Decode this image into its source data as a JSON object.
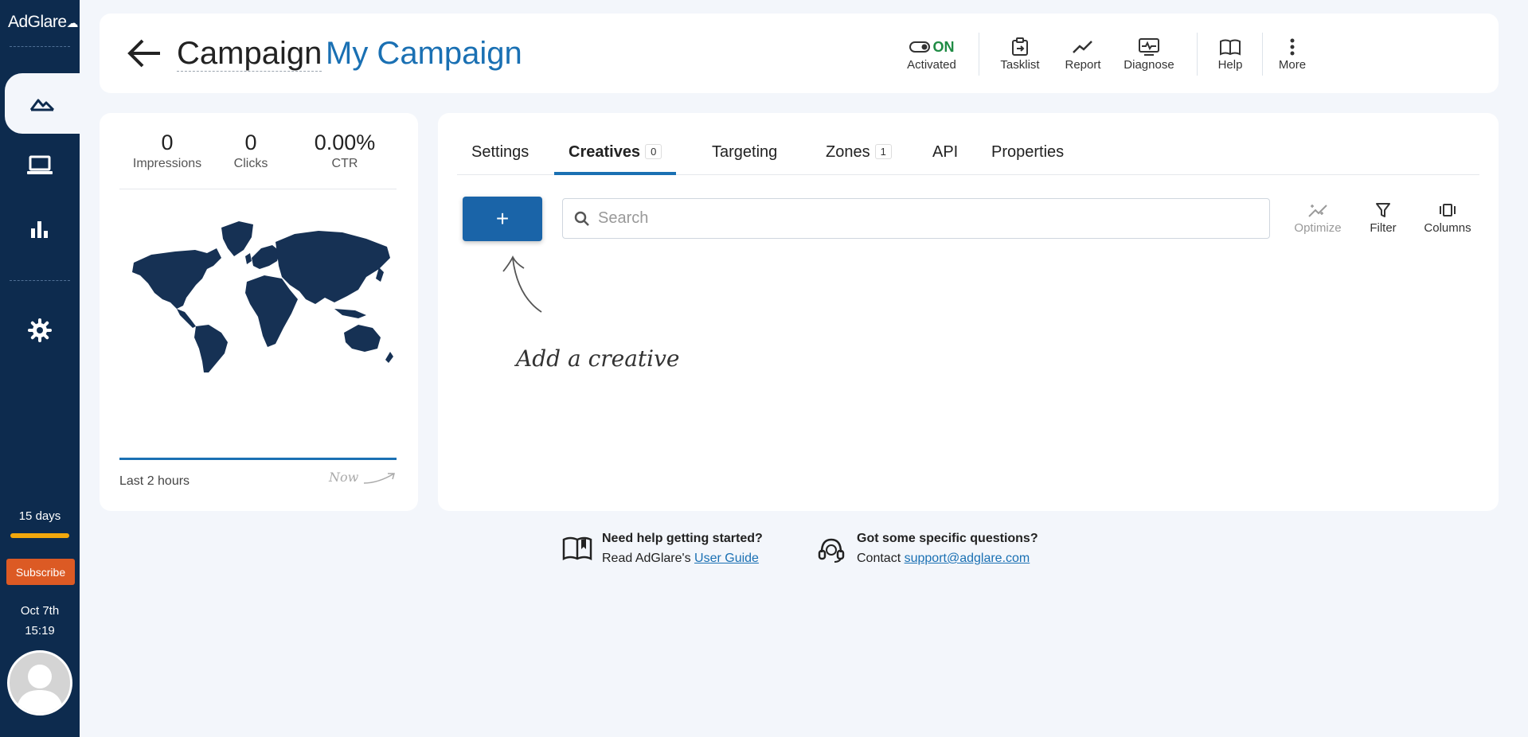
{
  "sidebar": {
    "logo": "AdGlare",
    "trial": {
      "days_left": "15 days",
      "remaining_fraction": 0.93
    },
    "subscribe_label": "Subscribe",
    "date": "Oct 7th",
    "time": "15:19"
  },
  "header": {
    "title_label": "Campaign",
    "title_name": "My Campaign",
    "status_on": "ON",
    "status_label": "Activated",
    "actions": [
      "Tasklist",
      "Report",
      "Diagnose",
      "Help",
      "More"
    ]
  },
  "stats": {
    "impressions": {
      "value": "0",
      "label": "Impressions"
    },
    "clicks": {
      "value": "0",
      "label": "Clicks"
    },
    "ctr": {
      "value": "0.00%",
      "label": "CTR"
    },
    "range_label": "Last 2 hours",
    "now_label": "Now"
  },
  "tabs": [
    {
      "label": "Settings"
    },
    {
      "label": "Creatives",
      "count": "0"
    },
    {
      "label": "Targeting"
    },
    {
      "label": "Zones",
      "count": "1"
    },
    {
      "label": "API"
    },
    {
      "label": "Properties"
    }
  ],
  "toolbar": {
    "add_label": "+",
    "search_placeholder": "Search",
    "optimize_label": "Optimize",
    "filter_label": "Filter",
    "columns_label": "Columns"
  },
  "hint": "Add a creative",
  "help": {
    "guide": {
      "title": "Need help getting started?",
      "prefix": "Read AdGlare's ",
      "link": "User Guide"
    },
    "support": {
      "title": "Got some specific questions?",
      "prefix": "Contact ",
      "link": "support@adglare.com"
    }
  },
  "colors": {
    "sidebar": "#0d2b4e",
    "accent": "#1a70b3",
    "status_on": "#1f8b44",
    "subscribe": "#dc5a24",
    "trial_bar": "#f3a80c"
  }
}
